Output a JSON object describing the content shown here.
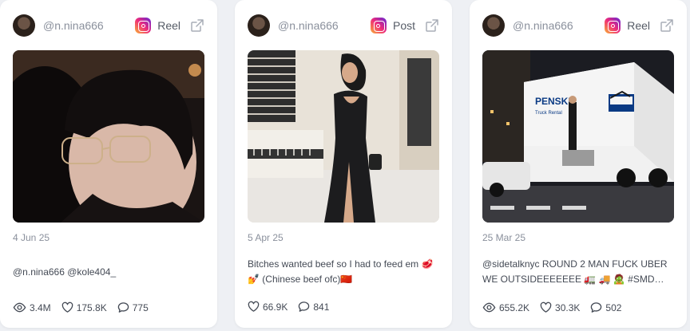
{
  "cards": [
    {
      "username": "@n.nina666",
      "post_type": "Reel",
      "date": "4 Jun 25",
      "caption": "@n.nina666 @kole404_",
      "views": "3.4M",
      "likes": "175.8K",
      "comments": "775"
    },
    {
      "username": "@n.nina666",
      "post_type": "Post",
      "date": "5 Apr 25",
      "caption": "Bitches wanted beef so I had to feed em 🥩 💅 (Chinese beef ofc)🇨🇳",
      "likes": "66.9K",
      "comments": "841"
    },
    {
      "username": "@n.nina666",
      "post_type": "Reel",
      "date": "25 Mar 25",
      "caption": "@sidetalknyc ROUND 2 MAN FUCK UBER WE OUTSIDEEEEEEE 🚛 🚚 🧟 #SMD…",
      "views": "655.2K",
      "likes": "30.3K",
      "comments": "502"
    }
  ],
  "icons": {
    "platform": "instagram-icon",
    "open": "external-link-icon",
    "views": "eye-icon",
    "likes": "heart-icon",
    "comments": "comment-icon"
  },
  "truck_text": {
    "brand": "PENSKE",
    "subtitle": "Truck Rental"
  }
}
